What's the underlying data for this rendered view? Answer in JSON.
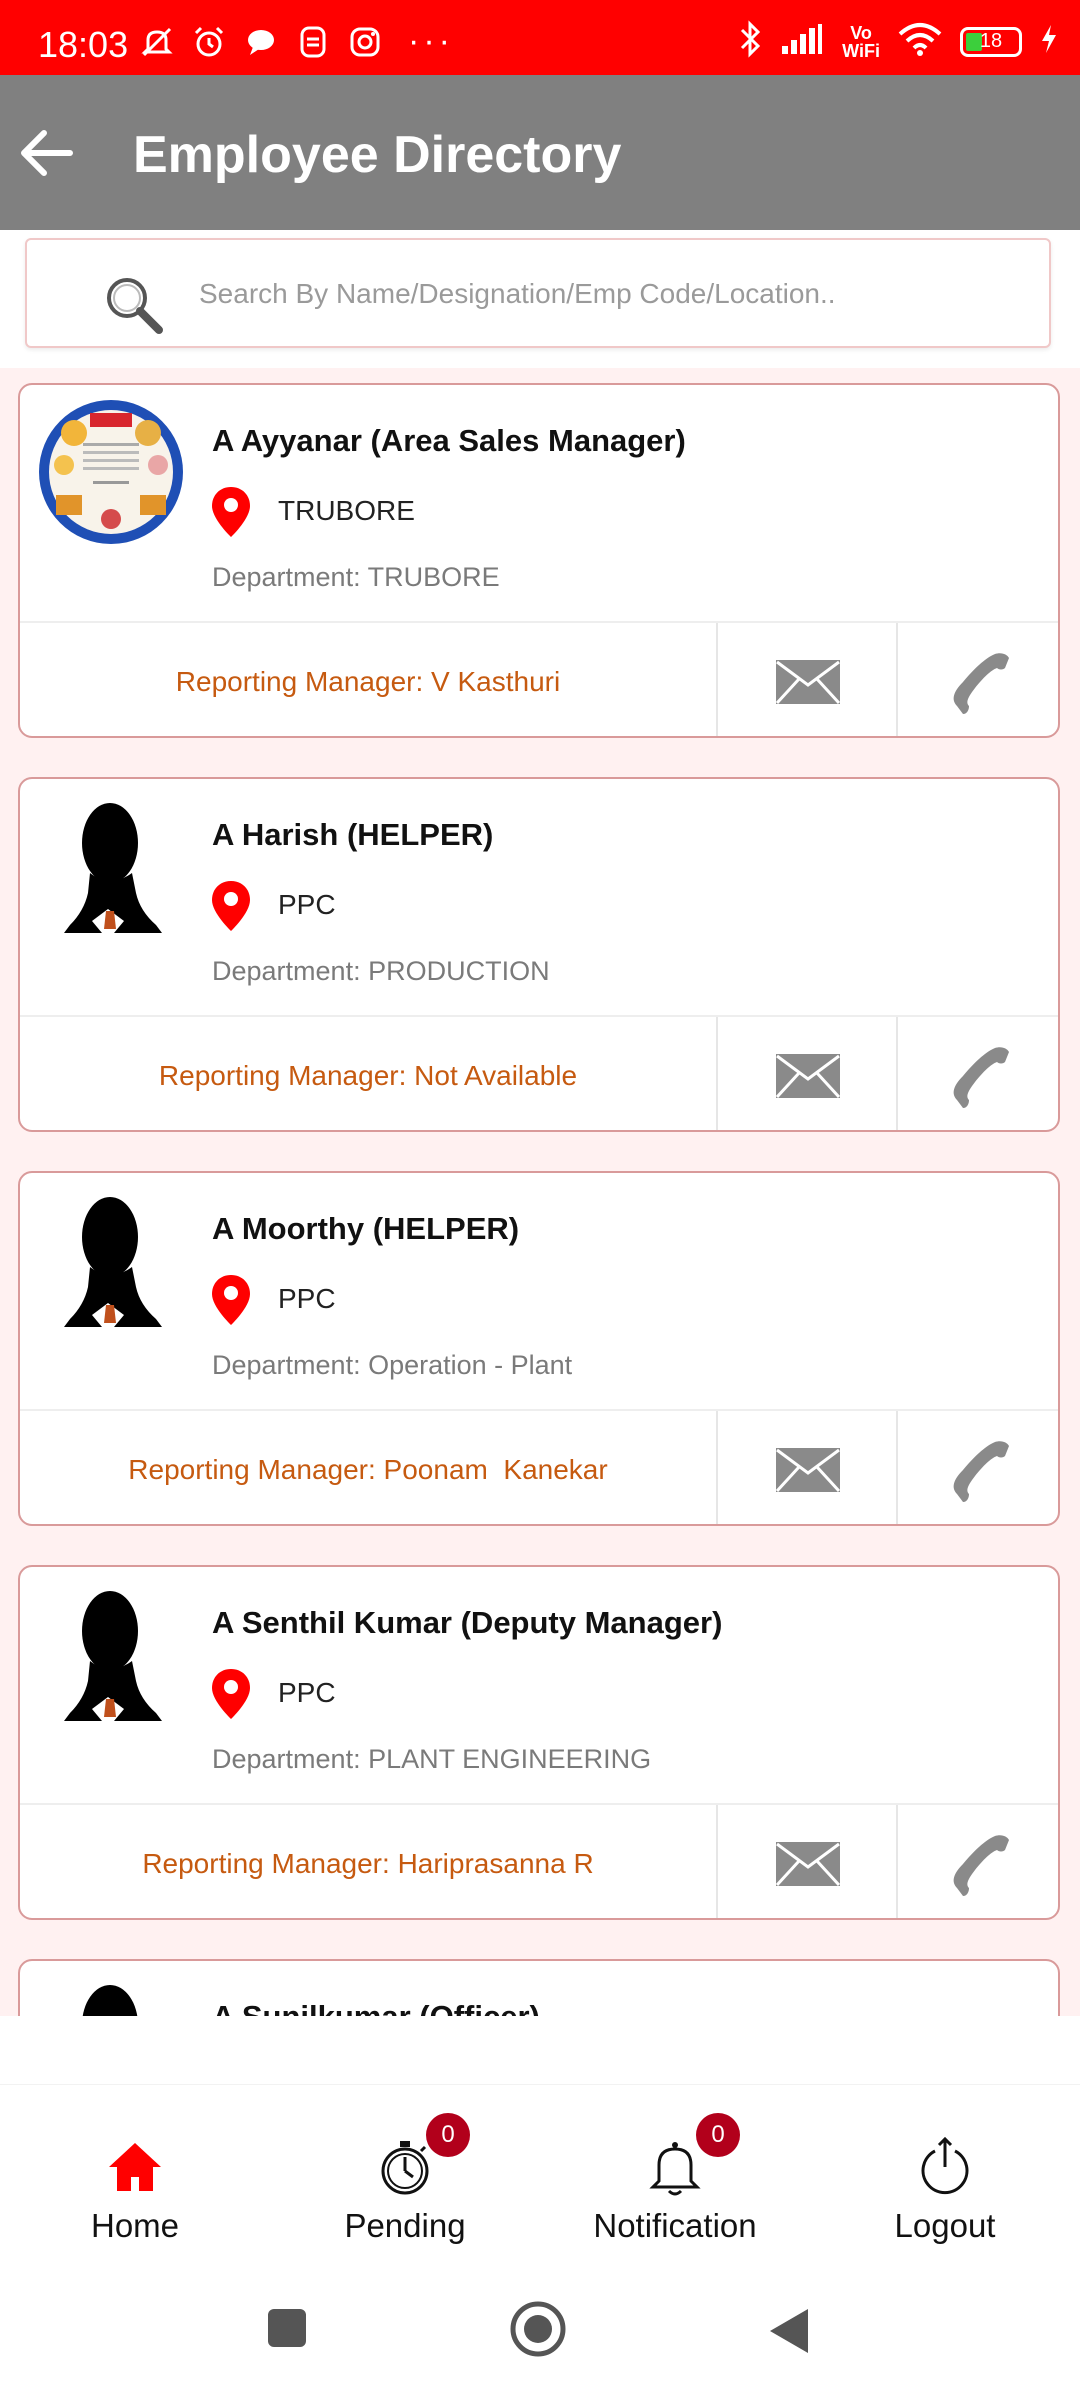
{
  "status_bar": {
    "time": "18:03",
    "network": "Vo\nWiFi",
    "battery": "18"
  },
  "app_bar": {
    "title": "Employee Directory"
  },
  "search": {
    "placeholder": "Search By Name/Designation/Emp Code/Location.."
  },
  "employees": [
    {
      "name": "A Ayyanar (Area Sales Manager)",
      "location": "TRUBORE",
      "department": "Department: TRUBORE",
      "manager": "Reporting Manager: V Kasthuri",
      "avatar": "birthday-card"
    },
    {
      "name": "A Harish (HELPER)",
      "location": "PPC",
      "department": "Department: PRODUCTION",
      "manager": "Reporting Manager: Not Available",
      "avatar": "silhouette"
    },
    {
      "name": "A Moorthy (HELPER)",
      "location": "PPC",
      "department": "Department: Operation - Plant",
      "manager": "Reporting Manager: Poonam  Kanekar",
      "avatar": "silhouette"
    },
    {
      "name": "A Senthil Kumar (Deputy Manager)",
      "location": "PPC",
      "department": "Department: PLANT ENGINEERING",
      "manager": "Reporting Manager: Hariprasanna R",
      "avatar": "silhouette"
    },
    {
      "name": "A Sunilkumar (Officer)",
      "avatar": "silhouette"
    }
  ],
  "bottom_nav": [
    {
      "label": "Home",
      "icon": "home-icon",
      "active": true
    },
    {
      "label": "Pending",
      "icon": "stopwatch-icon",
      "badge": "0"
    },
    {
      "label": "Notification",
      "icon": "bell-icon",
      "badge": "0"
    },
    {
      "label": "Logout",
      "icon": "power-icon"
    }
  ],
  "colors": {
    "status_bar": "#ff0000",
    "app_bar": "#808080",
    "accent": "#ff0000",
    "manager_text": "#c65a10",
    "badge": "#b2001b"
  }
}
